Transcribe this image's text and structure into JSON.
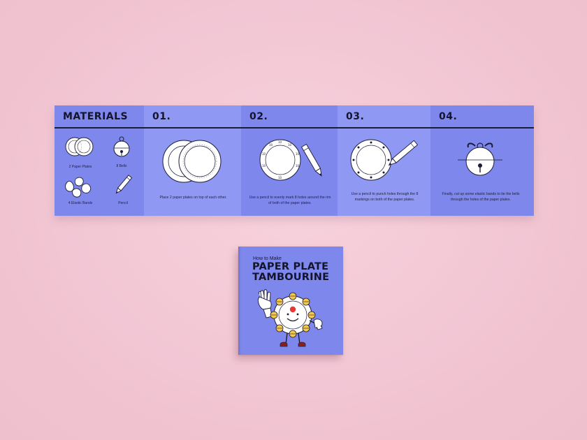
{
  "brochure": {
    "materials": {
      "heading": "MATERIALS",
      "items": [
        {
          "label": "2 Paper Plates",
          "icon": "paper-plates-icon"
        },
        {
          "label": "8 Bells",
          "icon": "bell-icon"
        },
        {
          "label": "4 Elastic Bands",
          "icon": "elastic-bands-icon"
        },
        {
          "label": "Pencil",
          "icon": "pencil-icon"
        }
      ]
    },
    "steps": [
      {
        "number": "01.",
        "text": "Place 2 paper plates on top of each other.",
        "icon": "stacked-plates-icon"
      },
      {
        "number": "02.",
        "text": "Use a pencil to evenly mark 8 holes around the rim of both of the paper plates.",
        "icon": "marked-plate-icon"
      },
      {
        "number": "03.",
        "text": "Use a pencil to punch holes through the 8 markings on both of the paper plates.",
        "icon": "punch-holes-icon"
      },
      {
        "number": "04.",
        "text": "Finally, cut up some elastic bands to tie the bells through the holes of the paper plates.",
        "icon": "tie-bell-icon"
      }
    ],
    "colors": {
      "panel_dark": "#7e88ec",
      "panel_light": "#8f99f4",
      "ink": "#14142c",
      "paper": "#ffffff"
    }
  },
  "booklet": {
    "subtitle": "How to Make",
    "title_line1": "PAPER PLATE",
    "title_line2": "TAMBOURINE",
    "character": "tambourine-mascot-icon",
    "colors": {
      "cover": "#7e88ec",
      "bells": "#f5c84a",
      "nose": "#e53935",
      "shoes": "#8b1d1d"
    }
  }
}
